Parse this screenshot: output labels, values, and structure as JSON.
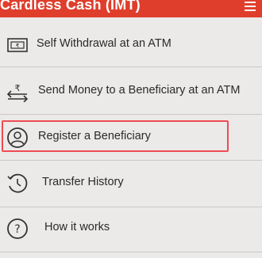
{
  "header": {
    "title": "Cardless Cash (IMT)"
  },
  "menu": {
    "items": [
      {
        "label": "Self Withdrawal at an ATM",
        "icon": "atm-cash-icon"
      },
      {
        "label": "Send Money to a Beneficiary at an ATM",
        "icon": "rupee-transfer-icon"
      },
      {
        "label": "Register a Beneficiary",
        "icon": "user-circle-icon"
      },
      {
        "label": "Transfer History",
        "icon": "history-clock-icon"
      },
      {
        "label": "How it works",
        "icon": "help-circle-icon"
      }
    ]
  },
  "colors": {
    "header": "#df3e2c",
    "highlight_border": "#ef4b53",
    "background": "#ebeae8"
  }
}
